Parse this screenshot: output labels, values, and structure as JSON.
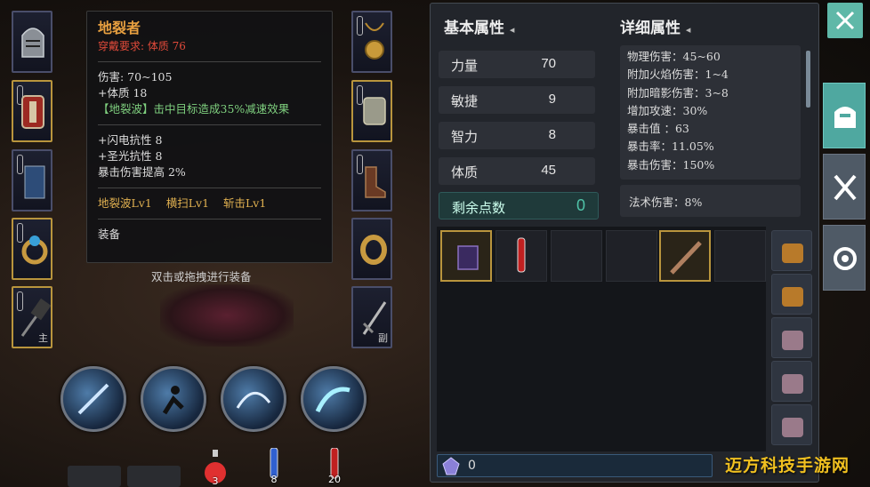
{
  "tooltip": {
    "name": "地裂者",
    "requirement": "穿戴要求:  体质  76",
    "damage": "伤害:  70~105",
    "stat1": "+体质  18",
    "effect": "【地裂波】击中目标造成35%减速效果",
    "resist1": "+闪电抗性  8",
    "resist2": "+圣光抗性  8",
    "crit": "暴击伤害提高    2%",
    "skill1": "地裂波Lv1",
    "skill2": "横扫Lv1",
    "skill3": "斩击Lv1",
    "action": "装备"
  },
  "hint": "双击或拖拽进行装备",
  "slots": {
    "weapon_main_tag": "主",
    "weapon_off_tag": "副"
  },
  "potions": [
    {
      "count": "3",
      "color": "#e03030"
    },
    {
      "count": "8",
      "color": "#3060d0"
    },
    {
      "count": "20",
      "color": "#c02020"
    }
  ],
  "basic": {
    "title": "基本属性",
    "rows": [
      {
        "label": "力量",
        "value": "70"
      },
      {
        "label": "敏捷",
        "value": "9"
      },
      {
        "label": "智力",
        "value": "8"
      },
      {
        "label": "体质",
        "value": "45"
      }
    ],
    "remaining_label": "剩余点数",
    "remaining_value": "0"
  },
  "detail": {
    "title": "详细属性",
    "lines": [
      "物理伤害：45~60",
      "附加火焰伤害：1~4",
      "附加暗影伤害：3~8",
      "增加攻速：30%",
      "暴击值 ：63",
      "暴击率：11.05%",
      "暴击伤害：150%"
    ],
    "magic": "法术伤害：8%"
  },
  "inventory": {
    "gem_count": "0"
  },
  "watermark": "迈方科技手游网",
  "colors": {
    "accent_teal": "#4fc3a8",
    "gold": "#b9953d",
    "item_name": "#e8a040",
    "requirement": "#e04a3a",
    "effect": "#7fd07f"
  }
}
